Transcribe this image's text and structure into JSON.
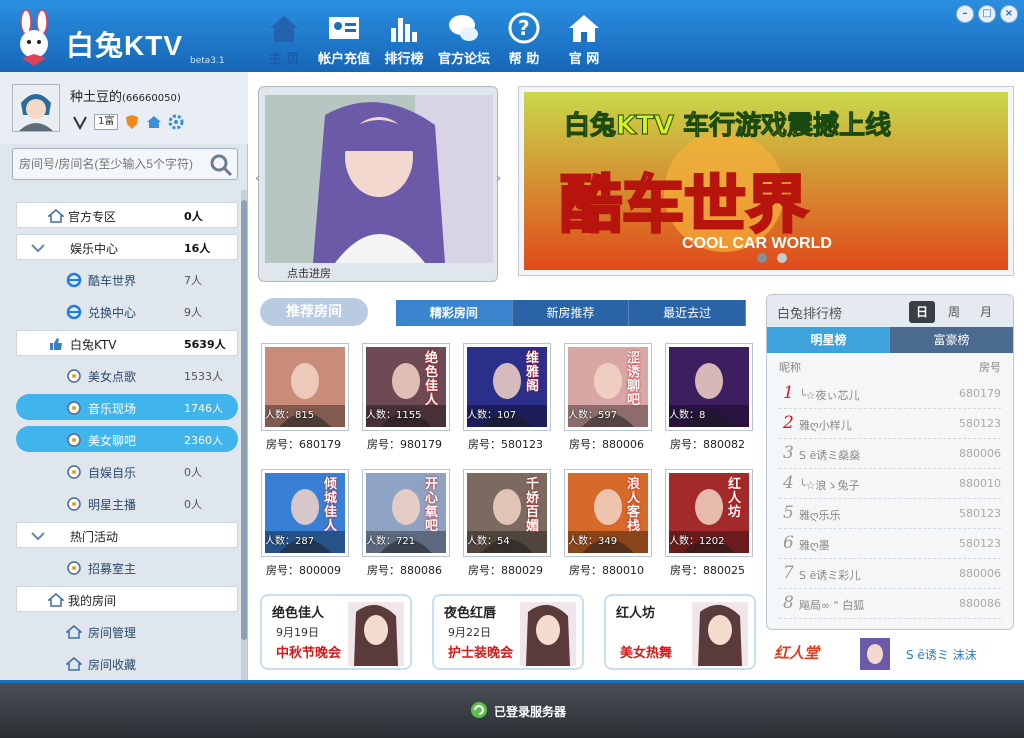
{
  "app": {
    "name": "白兔KTV",
    "version": "beta3.1"
  },
  "nav": [
    {
      "label": "主 页",
      "icon": "home-icon",
      "active": true
    },
    {
      "label": "帐户充值",
      "icon": "id-card-icon"
    },
    {
      "label": "排行榜",
      "icon": "bar-chart-icon"
    },
    {
      "label": "官方论坛",
      "icon": "chat-bubbles-icon"
    },
    {
      "label": "帮 助",
      "icon": "question-icon"
    },
    {
      "label": "官 网",
      "icon": "house-icon"
    }
  ],
  "user": {
    "name": "种土豆的",
    "id": "(66660050)",
    "rank_badge": "1富"
  },
  "search": {
    "placeholder": "房间号/房间名(至少输入5个字符)"
  },
  "sidebar": [
    {
      "label": "官方专区",
      "count": "0人",
      "kind": "cat",
      "icon": "house-icon"
    },
    {
      "label": "娱乐中心",
      "count": "16人",
      "kind": "cat",
      "icon": "chevron-down-icon"
    },
    {
      "label": "酷车世界",
      "count": "7人",
      "kind": "sub",
      "icon": "ie-icon"
    },
    {
      "label": "兑换中心",
      "count": "9人",
      "kind": "sub",
      "icon": "ie-icon"
    },
    {
      "label": "白兔KTV",
      "count": "5639人",
      "kind": "cat",
      "icon": "thumbs-up-icon"
    },
    {
      "label": "美女点歌",
      "count": "1533人",
      "kind": "sub",
      "icon": "room-icon"
    },
    {
      "label": "音乐现场",
      "count": "1746人",
      "kind": "hl",
      "icon": "room-icon"
    },
    {
      "label": "美女聊吧",
      "count": "2360人",
      "kind": "hl",
      "icon": "room-icon"
    },
    {
      "label": "自娱自乐",
      "count": "0人",
      "kind": "sub",
      "icon": "room-icon"
    },
    {
      "label": "明星主播",
      "count": "0人",
      "kind": "sub",
      "icon": "room-icon"
    },
    {
      "label": "热门活动",
      "count": "",
      "kind": "cat",
      "icon": "chevron-down-icon"
    },
    {
      "label": "招募室主",
      "count": "",
      "kind": "sub",
      "icon": "room-icon"
    },
    {
      "label": "我的房间",
      "count": "",
      "kind": "cat",
      "icon": "house-icon"
    },
    {
      "label": "房间管理",
      "count": "",
      "kind": "sub",
      "icon": "house-icon"
    },
    {
      "label": "房间收藏",
      "count": "",
      "kind": "sub",
      "icon": "house-icon"
    }
  ],
  "video": {
    "enter_label": "点击进房"
  },
  "banner": {
    "headline": "白兔KTV  车行游戏震撼上线",
    "big": "酷车世界",
    "sub": "COOL CAR WORLD"
  },
  "rooms_section": {
    "title": "推荐房间",
    "tabs": [
      "精彩房间",
      "新房推荐",
      "最近去过"
    ]
  },
  "rooms": [
    {
      "people": "人数：815",
      "room": "房号：680179",
      "color": "#c98b7a",
      "txt": ""
    },
    {
      "people": "人数：1155",
      "room": "房号：980179",
      "color": "#6e4a55",
      "txt": "绝色佳人"
    },
    {
      "people": "人数：107",
      "room": "房号：580123",
      "color": "#2a2f8a",
      "txt": "维雅阁"
    },
    {
      "people": "人数：597",
      "room": "房号：880006",
      "color": "#d9a6a6",
      "txt": "涩诱聊吧"
    },
    {
      "people": "人数：8",
      "room": "房号：880082",
      "color": "#3d1e5f",
      "txt": ""
    },
    {
      "people": "人数：287",
      "room": "房号：800009",
      "color": "#3a7fd6",
      "txt": "倾城佳人"
    },
    {
      "people": "人数：721",
      "room": "房号：880086",
      "color": "#8ea3c4",
      "txt": "开心氧吧"
    },
    {
      "people": "人数：54",
      "room": "房号：880029",
      "color": "#7a6a5f",
      "txt": "千娇百媚"
    },
    {
      "people": "人数：349",
      "room": "房号：880010",
      "color": "#d66a2a",
      "txt": "浪人客栈"
    },
    {
      "people": "人数：1202",
      "room": "房号：880025",
      "color": "#a32a2a",
      "txt": "红人坊"
    }
  ],
  "events": [
    {
      "l1": "绝色佳人",
      "l2": "9月19日",
      "l3": "中秋节晚会"
    },
    {
      "l1": "夜色红唇",
      "l2": "9月22日",
      "l3": "护士装晚会"
    },
    {
      "l1": "红人坊",
      "l2": "",
      "l3": "美女热舞"
    }
  ],
  "rank": {
    "title": "白兔排行榜",
    "periods": [
      "日",
      "周",
      "月"
    ],
    "tabs": [
      "明星榜",
      "富豪榜"
    ],
    "col_name": "昵称",
    "col_room": "房号",
    "rows": [
      {
        "n": "1",
        "name": "╰☆夜ぃ芯儿",
        "room": "680179"
      },
      {
        "n": "2",
        "name": "雅ღ小样儿",
        "room": "580123"
      },
      {
        "n": "3",
        "name": "S ё诱ミ燊燊",
        "room": "880006"
      },
      {
        "n": "4",
        "name": "╰☆浪ゝ兔子",
        "room": "880010"
      },
      {
        "n": "5",
        "name": "雅ღ乐乐",
        "room": "580123"
      },
      {
        "n": "6",
        "name": "雅ღ墨",
        "room": "580123"
      },
      {
        "n": "7",
        "name": "S ё诱ミ彩儿",
        "room": "880006"
      },
      {
        "n": "8",
        "name": "飚局∞ \" 白狐",
        "room": "880086"
      }
    ]
  },
  "promo": {
    "logo": "红人堂",
    "name": "S ё诱ミ 沫沫"
  },
  "footer": {
    "status": "已登录服务器"
  }
}
